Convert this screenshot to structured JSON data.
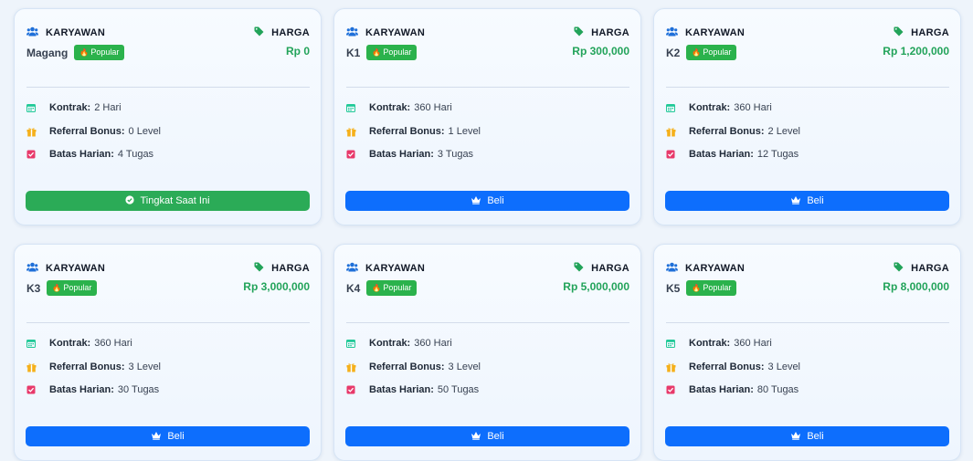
{
  "labels": {
    "category": "KARYAWAN",
    "price": "HARGA",
    "badge": "Popular",
    "contract": "Kontrak:",
    "referral": "Referral Bonus:",
    "daily": "Batas Harian:"
  },
  "colors": {
    "accent_green": "#22a35a",
    "badge_green": "#2bb24c",
    "button_blue": "#0d6efd",
    "button_green": "#2bab57",
    "calendar_teal": "#20c997",
    "gift_orange": "#f5b01a",
    "check_pink": "#e8396a",
    "users_blue": "#1e6fd9"
  },
  "icons": [
    "users-icon",
    "tag-icon",
    "calendar-icon",
    "gift-icon",
    "check-square-icon",
    "check-circle-icon",
    "crown-icon",
    "flame-icon"
  ],
  "plans": [
    {
      "name": "Magang",
      "price": "Rp 0",
      "contract": "2 Hari",
      "referral": "0 Level",
      "daily": "4 Tugas",
      "button": "Tingkat Saat Ini",
      "button_type": "current"
    },
    {
      "name": "K1",
      "price": "Rp 300,000",
      "contract": "360 Hari",
      "referral": "1 Level",
      "daily": "3 Tugas",
      "button": "Beli",
      "button_type": "buy"
    },
    {
      "name": "K2",
      "price": "Rp 1,200,000",
      "contract": "360 Hari",
      "referral": "2 Level",
      "daily": "12 Tugas",
      "button": "Beli",
      "button_type": "buy"
    },
    {
      "name": "K3",
      "price": "Rp 3,000,000",
      "contract": "360 Hari",
      "referral": "3 Level",
      "daily": "30 Tugas",
      "button": "Beli",
      "button_type": "buy"
    },
    {
      "name": "K4",
      "price": "Rp 5,000,000",
      "contract": "360 Hari",
      "referral": "3 Level",
      "daily": "50 Tugas",
      "button": "Beli",
      "button_type": "buy"
    },
    {
      "name": "K5",
      "price": "Rp 8,000,000",
      "contract": "360 Hari",
      "referral": "3 Level",
      "daily": "80 Tugas",
      "button": "Beli",
      "button_type": "buy"
    }
  ]
}
